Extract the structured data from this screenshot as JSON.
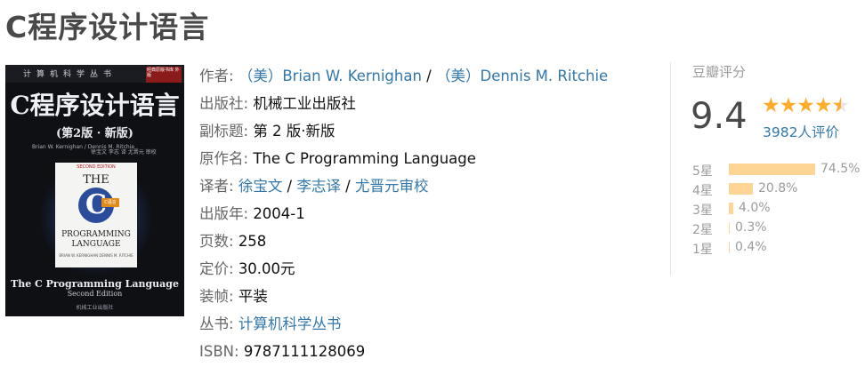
{
  "page": {
    "title": "C程序设计语言"
  },
  "cover": {
    "series": "计算机科学丛书",
    "tag": "经典原版书库 外版",
    "main_title": "C程序设计语言",
    "edition": "(第2版 · 新版)",
    "authors": "Brian W. Kernighan / Dennis M. Ritchie",
    "translators": "徐宝文 李志 译 尤晋元 审校",
    "second_edition": "SECOND EDITION",
    "the": "THE",
    "c_letter": "C",
    "badge": "C语言",
    "programming": "PROGRAMMING LANGUAGE",
    "by_line": "BRIAN W. KERNIGHAN DENNIS M. RITCHIE",
    "en_title": "The C Programming Language",
    "en_edition": "Second Edition",
    "publisher": "机械工业出版社"
  },
  "info": {
    "author_label": "作者:",
    "author1": "（美）Brian W. Kernighan",
    "author_sep": " / ",
    "author2": "（美）Dennis M. Ritchie",
    "publisher_label": "出版社:",
    "publisher": "机械工业出版社",
    "subtitle_label": "副标题:",
    "subtitle": "第 2 版·新版",
    "original_label": "原作名:",
    "original": "The C Programming Language",
    "translator_label": "译者:",
    "translator1": "徐宝文",
    "translator_sep1": " / ",
    "translator2": "李志译",
    "translator_sep2": " / ",
    "translator3": "尤晋元审校",
    "year_label": "出版年:",
    "year": "2004-1",
    "pages_label": "页数:",
    "pages": "258",
    "price_label": "定价:",
    "price": "30.00元",
    "binding_label": "装帧:",
    "binding": "平装",
    "series_label": "丛书:",
    "series": "计算机科学丛书",
    "isbn_label": "ISBN:",
    "isbn": "9787111128069"
  },
  "rating": {
    "title": "豆瓣评分",
    "score": "9.4",
    "stars_value": 4.5,
    "votes": "3982人评价",
    "accent_color": "#ffac2d",
    "bar_color": "#ffd596",
    "distribution": [
      {
        "label": "5星",
        "pct": "74.5%",
        "value": 74.5
      },
      {
        "label": "4星",
        "pct": "20.8%",
        "value": 20.8
      },
      {
        "label": "3星",
        "pct": "4.0%",
        "value": 4.0
      },
      {
        "label": "2星",
        "pct": "0.3%",
        "value": 0.3
      },
      {
        "label": "1星",
        "pct": "0.4%",
        "value": 0.4
      }
    ]
  }
}
